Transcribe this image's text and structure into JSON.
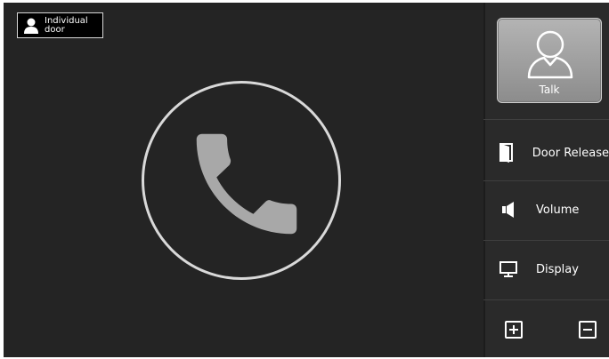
{
  "badge": {
    "text": "Individual door",
    "icon": "person-icon"
  },
  "call": {
    "icon": "phone-handset-icon"
  },
  "sidebar": {
    "talk_label": "Talk",
    "door_release_label": "Door Release",
    "volume_label": "Volume",
    "display_label": "Display"
  },
  "colors": {
    "background": "#242424",
    "sidebar": "#2a2a2a",
    "talk_button": "#a0a0a0",
    "circle": "#d9d9d9"
  }
}
